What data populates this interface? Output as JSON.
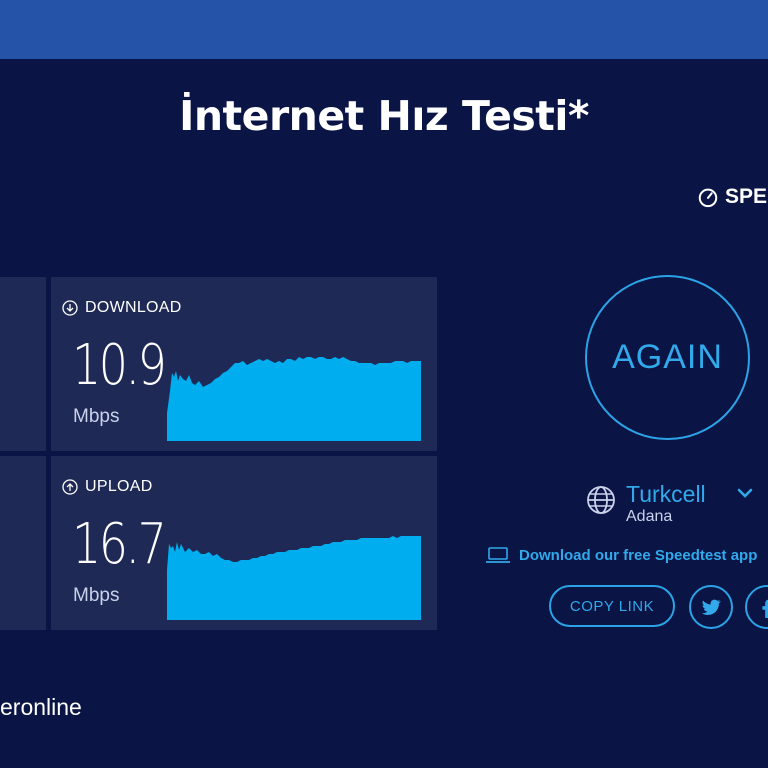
{
  "page": {
    "title": "İnternet Hız Testi*"
  },
  "brand": {
    "label": "SPE",
    "icon": "speedometer-icon"
  },
  "download": {
    "label": "DOWNLOAD",
    "icon": "download-arrow-icon",
    "value": "10.9",
    "unit": "Mbps",
    "color": "#00aeef"
  },
  "upload": {
    "label": "UPLOAD",
    "icon": "upload-arrow-icon",
    "value": "16.7",
    "unit": "Mbps",
    "color": "#00aeef"
  },
  "again_button": {
    "label": "AGAIN"
  },
  "isp": {
    "name": "Turkcell",
    "location": "Adana",
    "icon": "globe-icon"
  },
  "app_link": {
    "label": "Download our free Speedtest app",
    "icon": "laptop-icon"
  },
  "share": {
    "copy_label": "COPY LINK",
    "twitter_icon": "twitter-icon",
    "facebook_icon": "facebook-icon"
  },
  "footer": {
    "text": "eronline"
  },
  "colors": {
    "accent": "#31a9ea",
    "background": "#0a1445",
    "panel": "#1e2a55",
    "topbar": "#2453a8"
  }
}
